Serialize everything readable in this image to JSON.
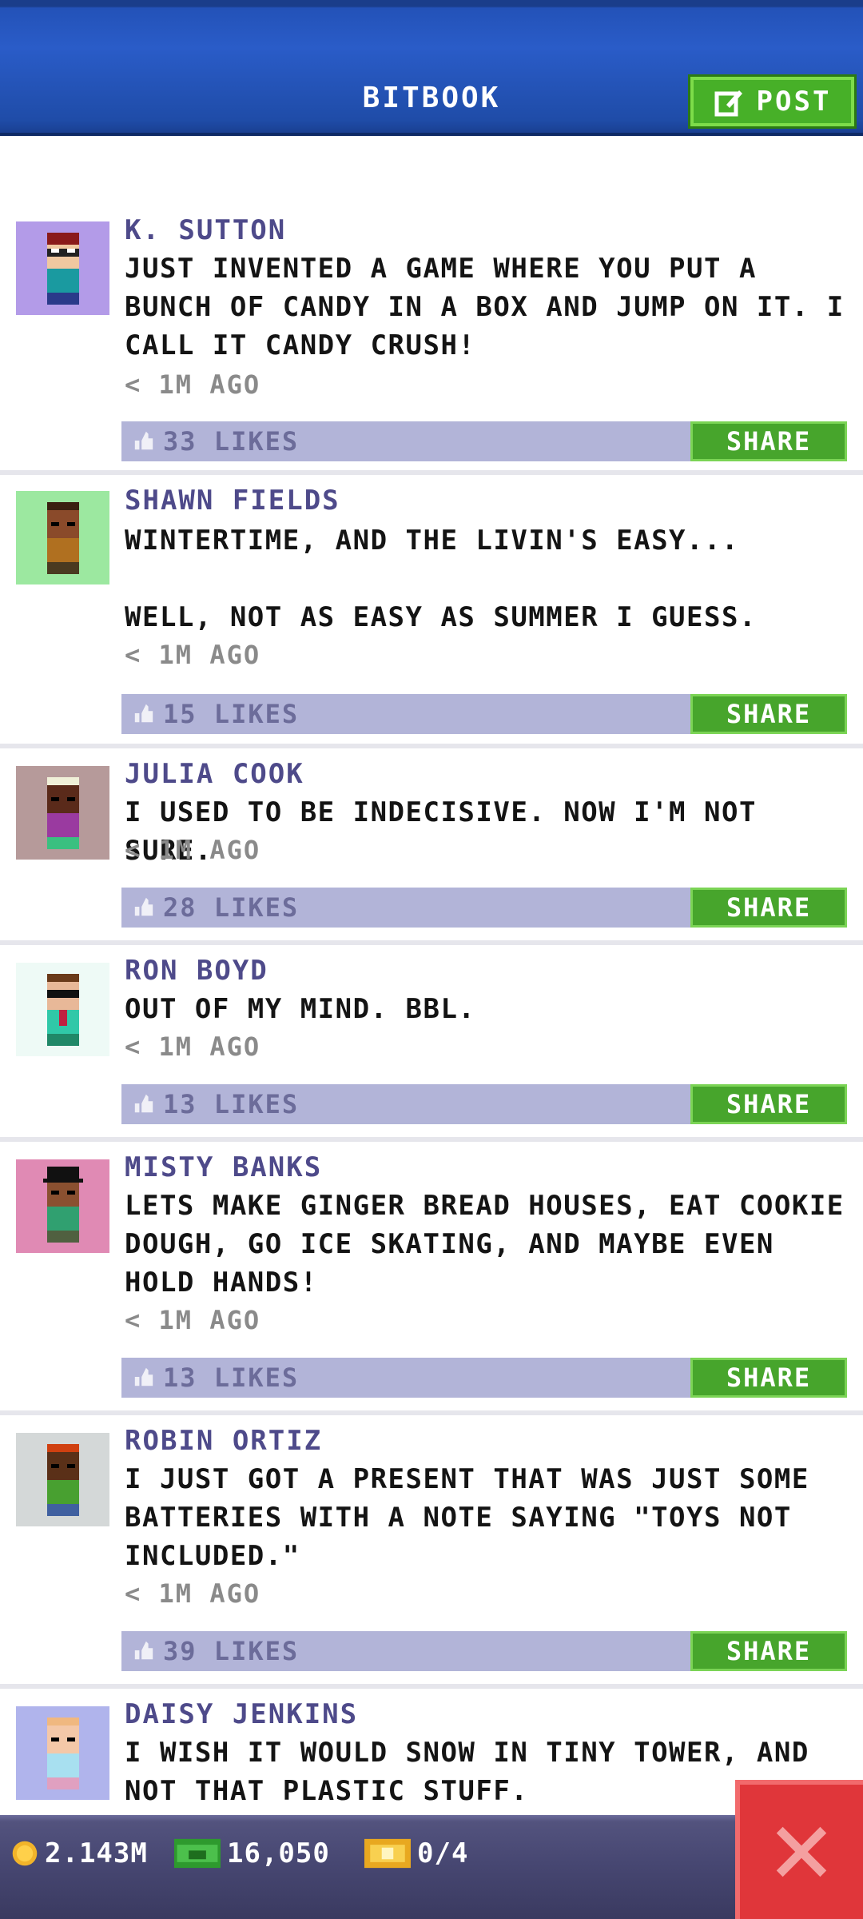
{
  "header": {
    "title": "BITBOOK",
    "post_label": "POST"
  },
  "feed": {
    "posts": [
      {
        "author": "K. SUTTON",
        "text": "JUST INVENTED A GAME WHERE YOU PUT A BUNCH OF CANDY IN A BOX AND JUMP ON IT. I CALL IT CANDY CRUSH!",
        "time": "< 1M AGO",
        "likes": "33 LIKES",
        "share_label": "SHARE",
        "avatar_bg": "#b39be8"
      },
      {
        "author": "SHAWN FIELDS",
        "text": "WINTERTIME, AND THE LIVIN'S EASY...\n\nWELL, NOT AS EASY AS SUMMER I GUESS.",
        "time": "< 1M AGO",
        "likes": "15 LIKES",
        "share_label": "SHARE",
        "avatar_bg": "#9ce8a0"
      },
      {
        "author": "JULIA COOK",
        "text": "I USED TO BE INDECISIVE. NOW I'M NOT SURE.",
        "time": "< 1M AGO",
        "likes": "28 LIKES",
        "share_label": "SHARE",
        "avatar_bg": "#b69a9a"
      },
      {
        "author": "RON BOYD",
        "text": "OUT OF MY MIND. BBL.",
        "time": "< 1M AGO",
        "likes": "13 LIKES",
        "share_label": "SHARE",
        "avatar_bg": "#eefaf6"
      },
      {
        "author": "MISTY BANKS",
        "text": "LETS MAKE GINGER BREAD HOUSES, EAT COOKIE DOUGH, GO ICE SKATING, AND MAYBE EVEN HOLD HANDS!",
        "time": "< 1M AGO",
        "likes": "13 LIKES",
        "share_label": "SHARE",
        "avatar_bg": "#e08ab4"
      },
      {
        "author": "ROBIN ORTIZ",
        "text": "I JUST GOT A PRESENT THAT WAS JUST SOME BATTERIES WITH A NOTE SAYING \"TOYS NOT INCLUDED.\"",
        "time": "< 1M AGO",
        "likes": "39 LIKES",
        "share_label": "SHARE",
        "avatar_bg": "#d4d8d8"
      },
      {
        "author": "DAISY JENKINS",
        "text": "I WISH IT WOULD SNOW IN TINY TOWER, AND NOT THAT PLASTIC STUFF.",
        "avatar_bg": "#b0b4ec"
      }
    ]
  },
  "bottom_bar": {
    "coins": "2.143M",
    "bux": "16,050",
    "tickets": "0/4"
  },
  "colors": {
    "header_blue": "#2352b8",
    "share_green": "#47a52c",
    "likes_bar": "#b2b4d8",
    "close_red": "#e0363a"
  }
}
